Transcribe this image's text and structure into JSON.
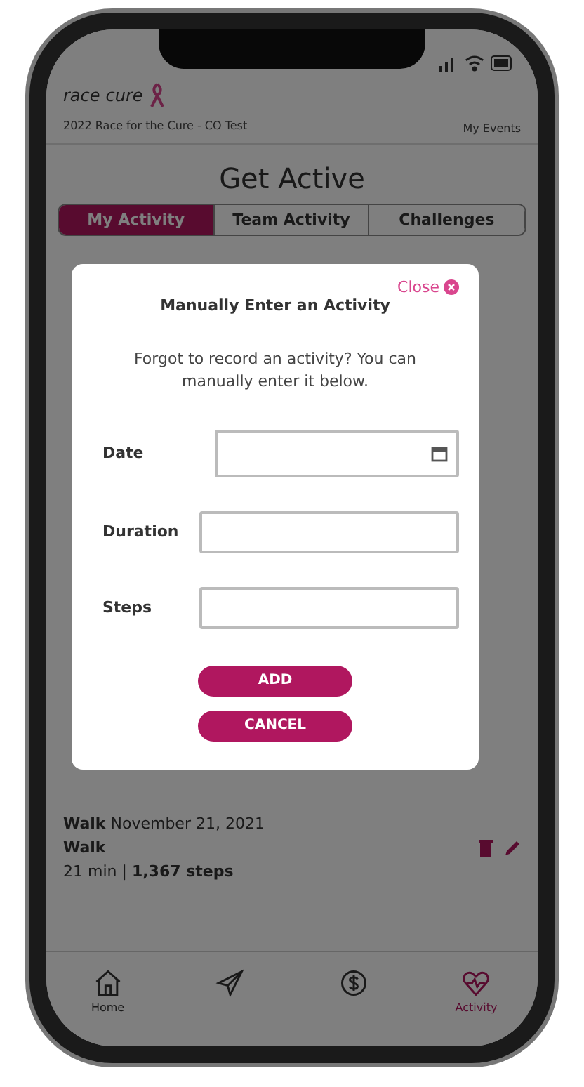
{
  "header": {
    "logo_words": [
      "race",
      "cure"
    ],
    "event": "2022 Race for the Cure - CO Test",
    "menu": "My Events"
  },
  "title": "Get Active",
  "tabs": [
    {
      "label": "My Activity",
      "selected": true
    },
    {
      "label": "Team Activity",
      "selected": false
    },
    {
      "label": "Challenges",
      "selected": false
    }
  ],
  "activity": {
    "name": "Walk",
    "date": "November 21, 2021",
    "type": "Walk",
    "duration": "21 min",
    "separator": "|",
    "steps": "1,367 steps"
  },
  "nav": [
    {
      "kind": "home",
      "label": "Home",
      "selected": false
    },
    {
      "kind": "send",
      "selected": false
    },
    {
      "kind": "dollar",
      "selected": false
    },
    {
      "kind": "heart",
      "label": "Activity",
      "selected": true
    }
  ],
  "modal": {
    "close": "Close",
    "title": "Manually Enter an Activity",
    "text": "Forgot to record an activity? You can manually enter it below.",
    "fields": [
      {
        "label": "Date",
        "kind": "date"
      },
      {
        "label": "Duration",
        "kind": "text"
      },
      {
        "label": "Steps",
        "kind": "text"
      }
    ],
    "buttons": [
      "ADD",
      "CANCEL"
    ]
  }
}
